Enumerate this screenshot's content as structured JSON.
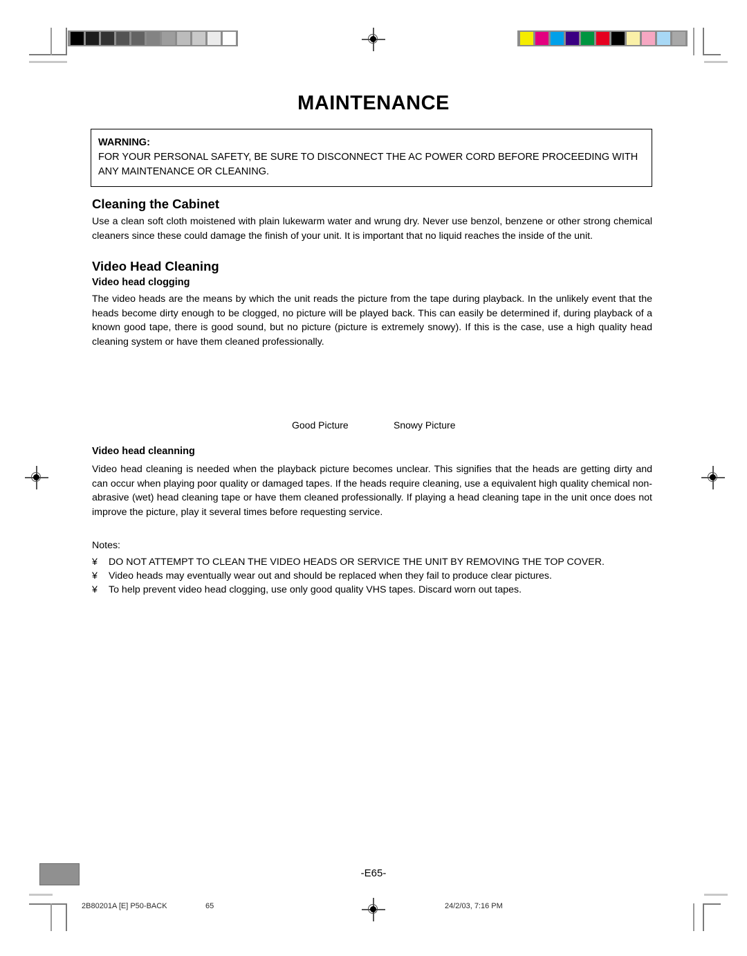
{
  "document": {
    "title": "MAINTENANCE",
    "page_marker": "-E65-"
  },
  "warning": {
    "label": "WARNING:",
    "body": "FOR YOUR PERSONAL SAFETY, BE SURE TO DISCONNECT THE AC POWER CORD BEFORE PROCEEDING WITH ANY MAINTENANCE OR CLEANING."
  },
  "sections": {
    "cabinet": {
      "heading": "Cleaning the Cabinet",
      "body": "Use a clean soft cloth moistened with plain lukewarm water and wrung dry. Never use benzol, benzene or other strong chemical cleaners since these could damage the finish of your unit. It is important that no liquid reaches the inside of the unit."
    },
    "video_head_cleaning": {
      "heading": "Video Head Cleaning",
      "clogging": {
        "subheading": "Video head clogging",
        "body": "The video heads are the means by which the unit reads the picture from the tape during playback. In the unlikely event that the heads become dirty enough to be clogged, no picture will be played back. This can easily be determined if, during playback of a known good tape, there is good sound, but no picture (picture is extremely snowy). If this is the case, use a high quality head cleaning system or have them cleaned professionally."
      },
      "figures": {
        "good_picture_caption": "Good Picture",
        "snowy_picture_caption": "Snowy Picture"
      },
      "cleaning": {
        "subheading": "Video head cleanning",
        "body": "Video head cleaning is needed when the playback picture becomes unclear. This signifies that the heads are getting dirty and can occur when playing poor quality or damaged tapes. If the heads require cleaning, use a equivalent high quality chemical non-abrasive (wet) head cleaning tape or have them cleaned professionally. If playing a head cleaning tape in the unit once does not improve the picture, play it several times before requesting service."
      }
    }
  },
  "notes": {
    "label": "Notes:",
    "bullet_glyph": "¥",
    "items": [
      "DO NOT ATTEMPT TO CLEAN THE VIDEO HEADS OR SERVICE THE UNIT BY REMOVING THE TOP COVER.",
      "Video heads may eventually wear out and should be replaced when they fail to produce clear pictures.",
      "To help prevent video head clogging, use only good quality VHS tapes. Discard worn out tapes."
    ]
  },
  "footer": {
    "job_id": "2B80201A [E] P50-BACK",
    "page_number": "65",
    "timestamp": "24/2/03, 7:16 PM"
  },
  "print_marks": {
    "grayscale_swatches": [
      "#000000",
      "#1c1c1c",
      "#333333",
      "#545454",
      "#636363",
      "#838383",
      "#9d9d9d",
      "#bcbcbc",
      "#c9c9c9",
      "#ebebeb",
      "#ffffff"
    ],
    "color_swatches": [
      "#f5ec00",
      "#e3007f",
      "#00a0e9",
      "#3a0082",
      "#009540",
      "#e60020",
      "#000000",
      "#faf0a8",
      "#f6a7c2",
      "#a8d8f5",
      "#a8a8a8"
    ],
    "strip_background": "#8c8c8c",
    "corner_block": "#909090"
  }
}
